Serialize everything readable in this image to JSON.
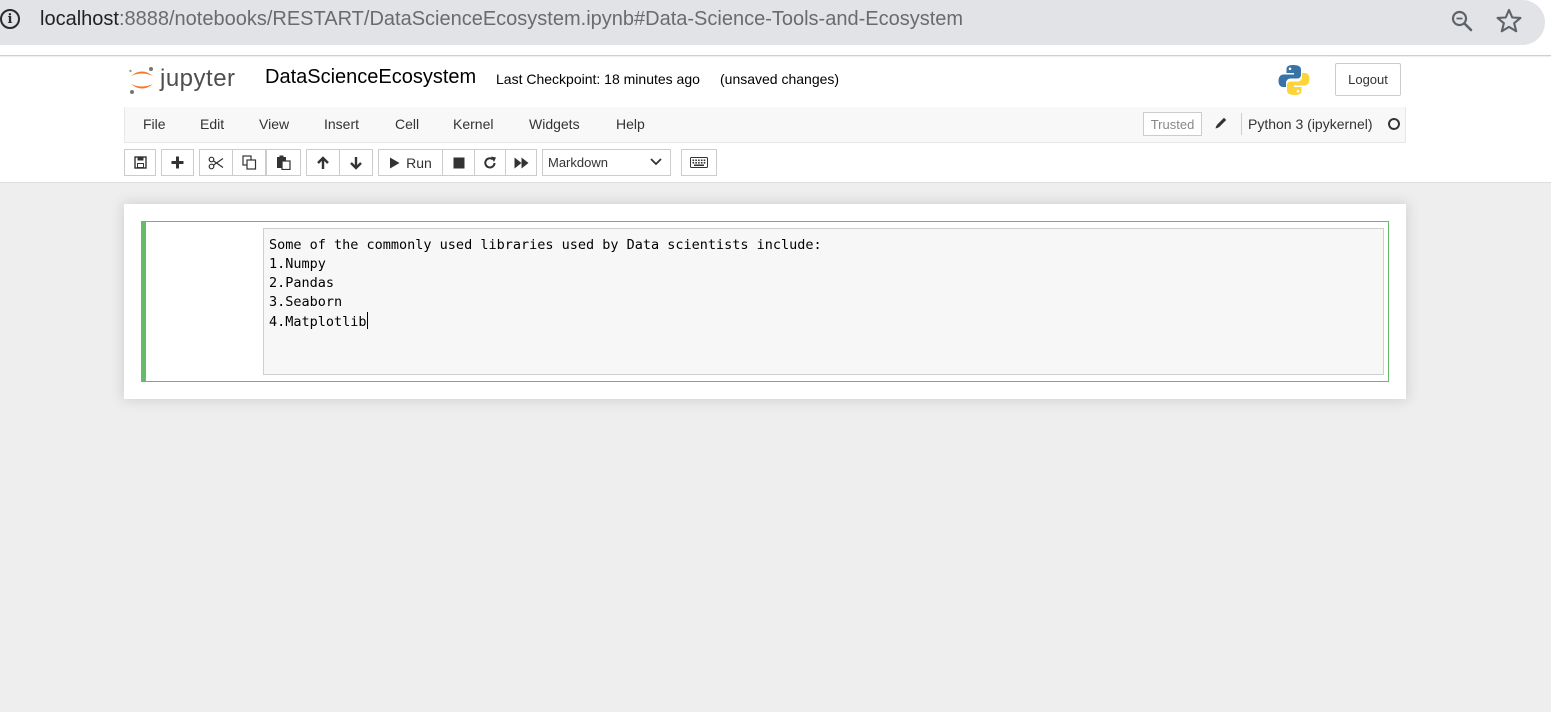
{
  "browser": {
    "url_host": "localhost",
    "url_path": ":8888/notebooks/RESTART/DataScienceEcosystem.ipynb#Data-Science-Tools-and-Ecosystem",
    "icons": [
      "info-icon",
      "zoom-icon",
      "bookmark-star-icon"
    ]
  },
  "header": {
    "logo_text": "jupyter",
    "notebook_name": "DataScienceEcosystem",
    "checkpoint": "Last Checkpoint: 18 minutes ago",
    "unsaved": "(unsaved changes)",
    "logout_label": "Logout"
  },
  "menubar": {
    "items": [
      "File",
      "Edit",
      "View",
      "Insert",
      "Cell",
      "Kernel",
      "Widgets",
      "Help"
    ],
    "trusted_label": "Trusted",
    "kernel_name": "Python 3 (ipykernel)"
  },
  "toolbar": {
    "run_label": "Run",
    "cell_type": "Markdown"
  },
  "cell": {
    "lines": [
      "Some of the commonly used libraries used by Data scientists include:",
      "1.Numpy",
      "2.Pandas",
      "3.Seaborn",
      "4.Matplotlib"
    ]
  },
  "colors": {
    "cell_border_edit": "#66bb6a",
    "page_background": "#eeeeee",
    "logo_orange": "#f37726"
  }
}
